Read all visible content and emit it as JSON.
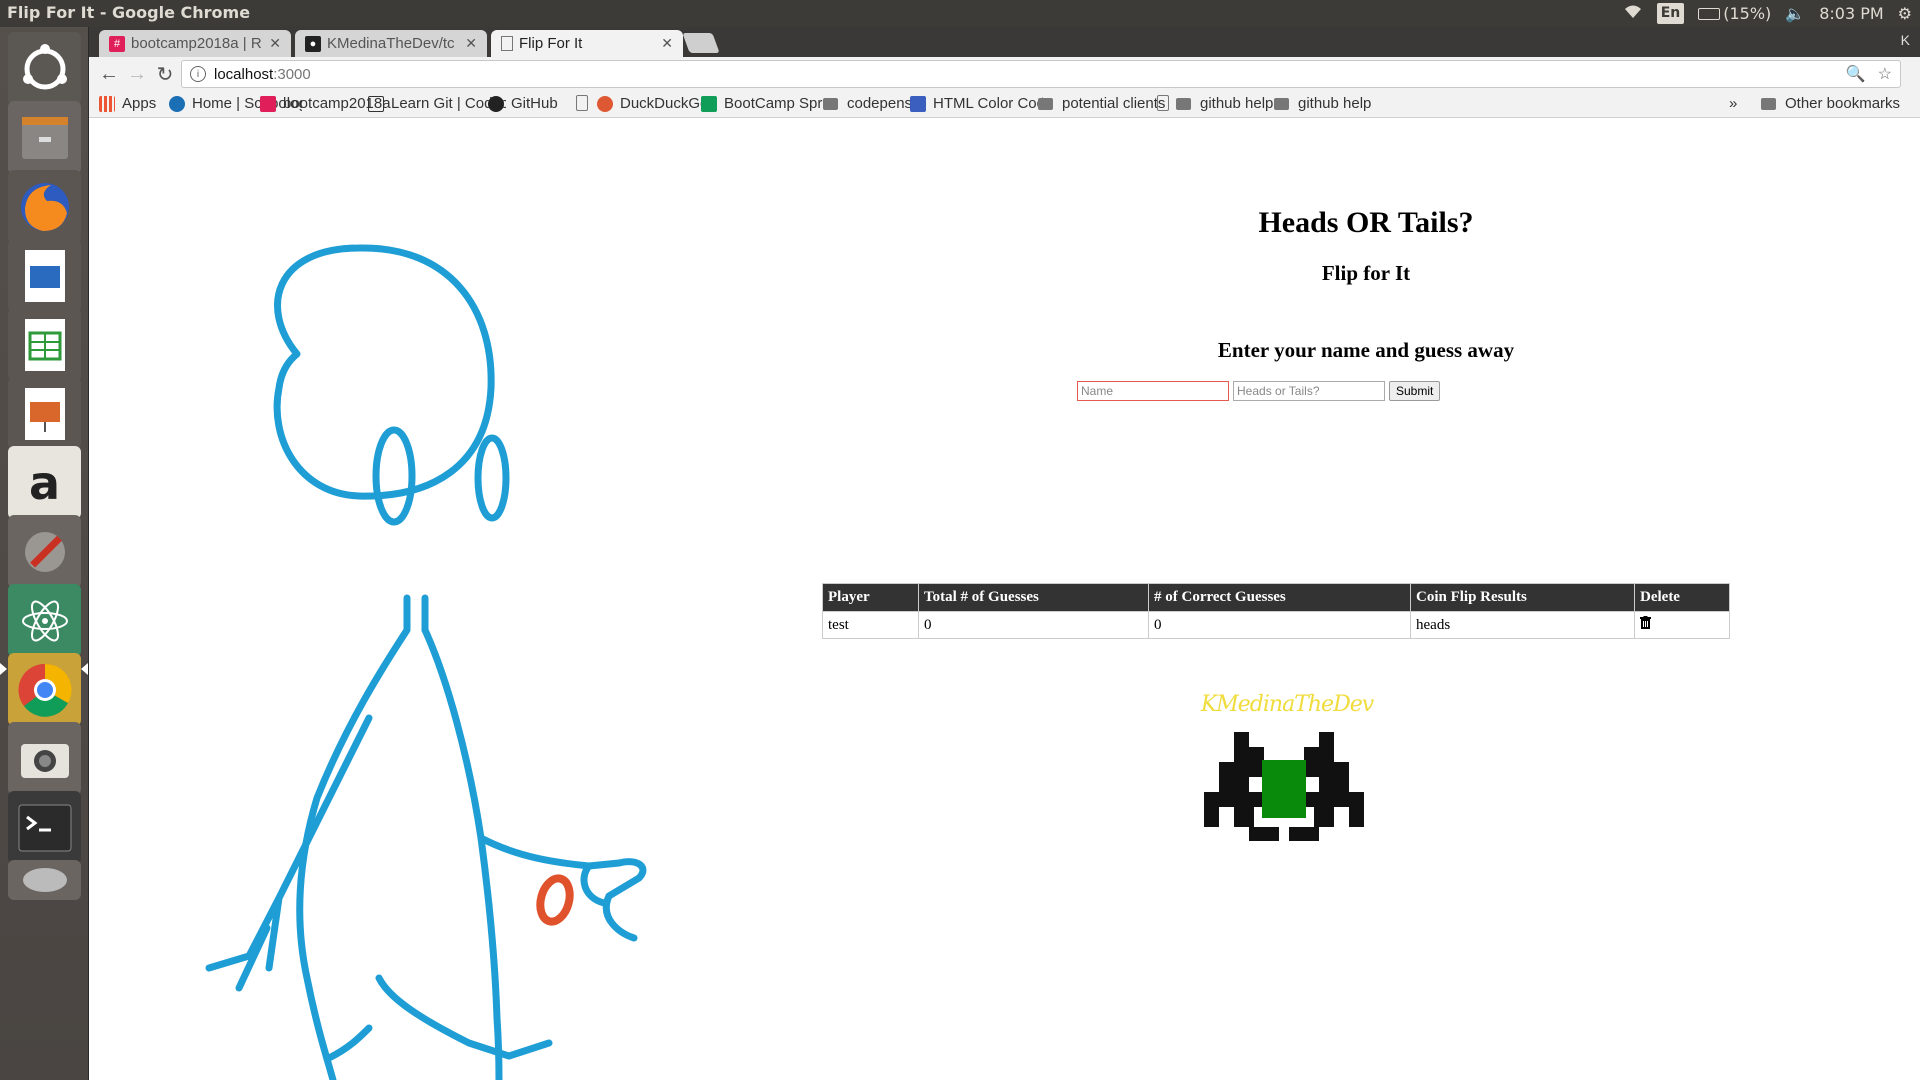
{
  "os": {
    "window_title": "Flip For It - Google Chrome",
    "language": "En",
    "battery": "(15%)",
    "clock": "8:03 PM"
  },
  "browser": {
    "tabs": [
      {
        "label": "bootcamp2018a | R",
        "icon": "slack-icon",
        "color": "#e01e5a"
      },
      {
        "label": "KMedinaTheDev/tc",
        "icon": "github-icon",
        "color": "#222222"
      },
      {
        "label": "Flip For It",
        "icon": "page-icon",
        "color": "#666666"
      }
    ],
    "profile_initial": "K",
    "url_host": "localhost",
    "url_port": ":3000",
    "bookmarks": [
      {
        "label": "Apps",
        "icon": "apps-grid-icon"
      },
      {
        "label": "Home | Schoolog",
        "icon": "schoology-icon"
      },
      {
        "label": "bootcamp2018a",
        "icon": "slack-icon"
      },
      {
        "label": "Learn Git | Codec",
        "icon": "codecademy-icon"
      },
      {
        "label": "GitHub",
        "icon": "github-icon"
      },
      {
        "label": "",
        "icon": "page-icon"
      },
      {
        "label": "DuckDuckGo",
        "icon": "duckduckgo-icon"
      },
      {
        "label": "BootCamp Sprea",
        "icon": "sheets-icon"
      },
      {
        "label": "codepens",
        "icon": "folder-icon"
      },
      {
        "label": "HTML Color Cod",
        "icon": "color-icon"
      },
      {
        "label": "potential clients",
        "icon": "folder-icon"
      },
      {
        "label": "",
        "icon": "page-icon"
      },
      {
        "label": "github help",
        "icon": "folder-icon"
      },
      {
        "label": "github help",
        "icon": "folder-icon"
      }
    ],
    "overflow": "»",
    "other_bookmarks": "Other bookmarks"
  },
  "page": {
    "title": "Heads OR Tails?",
    "subtitle": "Flip for It",
    "prompt": "Enter your name and guess away",
    "name_placeholder": "Name",
    "guess_placeholder": "Heads or Tails?",
    "submit_label": "Submit",
    "table": {
      "headers": [
        "Player",
        "Total # of Guesses",
        "# of Correct Guesses",
        "Coin Flip Results",
        "Delete"
      ],
      "rows": [
        {
          "player": "test",
          "total": "0",
          "correct": "0",
          "result": "heads"
        }
      ]
    },
    "brand": "KMedinaTheDev",
    "colors": {
      "stickman": "#1e9ed5",
      "coin": "#e0522c",
      "brand": "#f0dc3c",
      "invader_body": "#111111",
      "invader_core": "#0a8a0a"
    }
  }
}
